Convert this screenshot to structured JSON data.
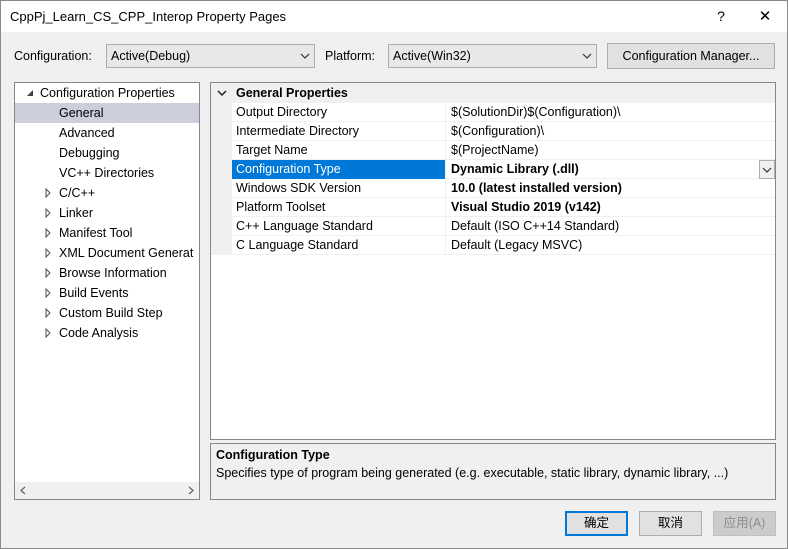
{
  "window": {
    "title": "CppPj_Learn_CS_CPP_Interop Property Pages",
    "help_glyph": "?",
    "close_glyph": "✕"
  },
  "toolbar": {
    "configuration_label": "Configuration:",
    "configuration_value": "Active(Debug)",
    "platform_label": "Platform:",
    "platform_value": "Active(Win32)",
    "config_manager_label": "Configuration Manager..."
  },
  "tree": {
    "root": "Configuration Properties",
    "items": [
      {
        "label": "General",
        "selected": true,
        "expandable": false
      },
      {
        "label": "Advanced",
        "expandable": false
      },
      {
        "label": "Debugging",
        "expandable": false
      },
      {
        "label": "VC++ Directories",
        "expandable": false
      },
      {
        "label": "C/C++",
        "expandable": true
      },
      {
        "label": "Linker",
        "expandable": true
      },
      {
        "label": "Manifest Tool",
        "expandable": true
      },
      {
        "label": "XML Document Generat",
        "expandable": true
      },
      {
        "label": "Browse Information",
        "expandable": true
      },
      {
        "label": "Build Events",
        "expandable": true
      },
      {
        "label": "Custom Build Step",
        "expandable": true
      },
      {
        "label": "Code Analysis",
        "expandable": true
      }
    ]
  },
  "grid": {
    "section_title": "General Properties",
    "rows": [
      {
        "name": "Output Directory",
        "value": "$(SolutionDir)$(Configuration)\\",
        "bold": false
      },
      {
        "name": "Intermediate Directory",
        "value": "$(Configuration)\\",
        "bold": false
      },
      {
        "name": "Target Name",
        "value": "$(ProjectName)",
        "bold": false
      },
      {
        "name": "Configuration Type",
        "value": "Dynamic Library (.dll)",
        "bold": true,
        "selected": true
      },
      {
        "name": "Windows SDK Version",
        "value": "10.0 (latest installed version)",
        "bold": true
      },
      {
        "name": "Platform Toolset",
        "value": "Visual Studio 2019 (v142)",
        "bold": true
      },
      {
        "name": "C++ Language Standard",
        "value": "Default (ISO C++14 Standard)",
        "bold": false
      },
      {
        "name": "C Language Standard",
        "value": "Default (Legacy MSVC)",
        "bold": false
      }
    ]
  },
  "description": {
    "title": "Configuration Type",
    "text": "Specifies type of program being generated (e.g. executable, static library, dynamic library, ...)"
  },
  "buttons": {
    "ok": "确定",
    "cancel": "取消",
    "apply": "应用(A)"
  },
  "colors": {
    "accent": "#0078d7",
    "tree_selection": "#cccedb"
  }
}
